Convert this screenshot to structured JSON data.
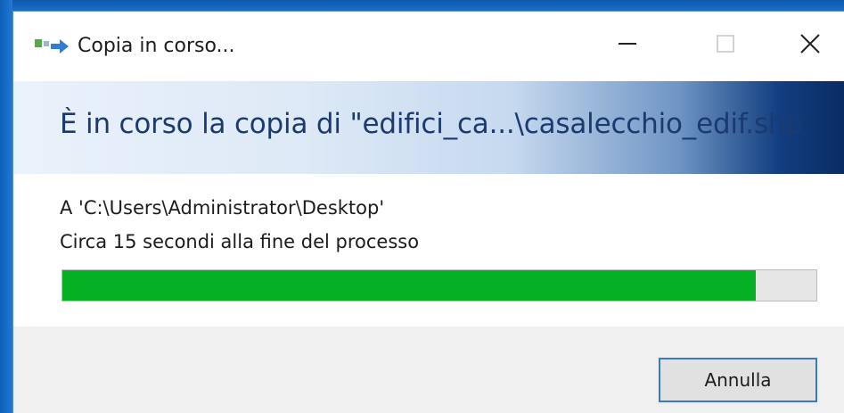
{
  "window": {
    "title": "Copia in corso...",
    "icon": "copy-arrow-icon",
    "controls": {
      "minimize": "minimize-icon",
      "maximize": "maximize-icon",
      "close": "close-icon"
    }
  },
  "banner": {
    "text": "È in corso la copia di \"edifici_ca...\\casalecchio_edif.shp"
  },
  "details": {
    "destination": "A 'C:\\Users\\Administrator\\Desktop'",
    "time_remaining": "Circa 15 secondi alla fine del processo"
  },
  "progress": {
    "percent": 92,
    "color": "#06b025"
  },
  "footer": {
    "cancel_label": "Annulla"
  },
  "colors": {
    "accent": "#3a78c8",
    "banner_text": "#1a3a70"
  }
}
